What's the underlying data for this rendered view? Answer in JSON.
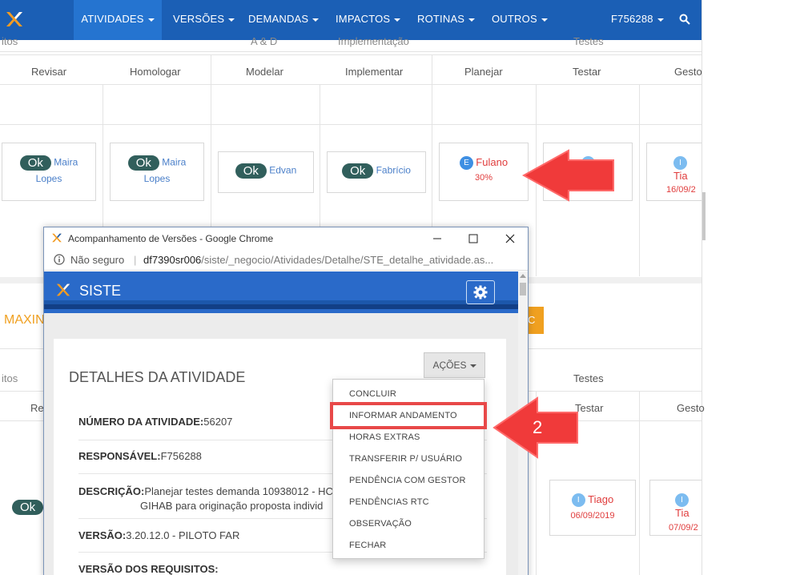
{
  "nav": {
    "items": [
      {
        "label": "ATIVIDADES",
        "active": true
      },
      {
        "label": "VERSÕES"
      },
      {
        "label": "DEMANDAS"
      },
      {
        "label": "IMPACTOS"
      },
      {
        "label": "ROTINAS"
      },
      {
        "label": "OUTROS"
      }
    ],
    "user": "F756288",
    "search_icon": "search-icon"
  },
  "table": {
    "group_labels": [
      "itos",
      "A & D",
      "Implementação",
      "Testes"
    ],
    "columns": [
      "Revisar",
      "Homologar",
      "Modelar",
      "Implementar",
      "Planejar",
      "Testar",
      "Gesto"
    ],
    "cards": [
      {
        "badge": "Ok",
        "name_line1": "Maira",
        "name_line2": "Lopes"
      },
      {
        "badge": "Ok",
        "name_line1": "Maira",
        "name_line2": "Lopes"
      },
      {
        "badge": "Ok",
        "name": "Edvan"
      },
      {
        "badge": "Ok",
        "name": "Fabrício"
      },
      {
        "initial": "E",
        "name": "Fulano",
        "progress": "30%"
      },
      {
        "initial": "I",
        "name": "Tia",
        "date": "16/09/2"
      }
    ]
  },
  "table2": {
    "group_left": "itos",
    "group_right": "Testes",
    "col_re": "Re",
    "col_testar": "Testar",
    "col_gesto": "Gesto",
    "ok_badge": "Ok",
    "cards": [
      {
        "initial": "I",
        "name": "Tiago",
        "date": "06/09/2019"
      },
      {
        "initial": "I",
        "name": "Tia",
        "date": "07/09/2"
      }
    ]
  },
  "maxim_label": "MAXIN",
  "orange_btn_label": "C",
  "arrow2_label": "2",
  "popup": {
    "window_title": "Acompanhamento de Versões - Google Chrome",
    "address": {
      "security": "Não seguro",
      "host": "df7390sr006",
      "path": "/siste/_negocio/Atividades/Detalhe/STE_detalhe_atividade.as..."
    },
    "app_name": "SISTE",
    "panel_title": "DETALHES DA ATIVIDADE",
    "acoes_label": "AÇÕES",
    "fields": [
      {
        "label": "NÚMERO DA ATIVIDADE:",
        "value": "56207"
      },
      {
        "label": "RESPONSÁVEL:",
        "value": "F756288"
      },
      {
        "label": "DESCRIÇÃO:",
        "value": "Planejar testes demanda 10938012 - HC",
        "value2": "GIHAB para originação proposta individ"
      },
      {
        "label": "VERSÃO:",
        "value": "3.20.12.0 - PILOTO FAR"
      },
      {
        "label": "VERSÃO DOS REQUISITOS:",
        "value": ""
      }
    ],
    "menu": [
      "CONCLUIR",
      "INFORMAR ANDAMENTO",
      "HORAS EXTRAS",
      "TRANSFERIR P/ USUÁRIO",
      "PENDÊNCIA COM GESTOR",
      "PENDÊNCIAS RTC",
      "OBSERVAÇÃO",
      "FECHAR"
    ]
  },
  "colors": {
    "nav": "#1b5fb5",
    "accent_red": "#e84848",
    "ok_badge": "#315f5c",
    "link": "#4a7fc9"
  }
}
